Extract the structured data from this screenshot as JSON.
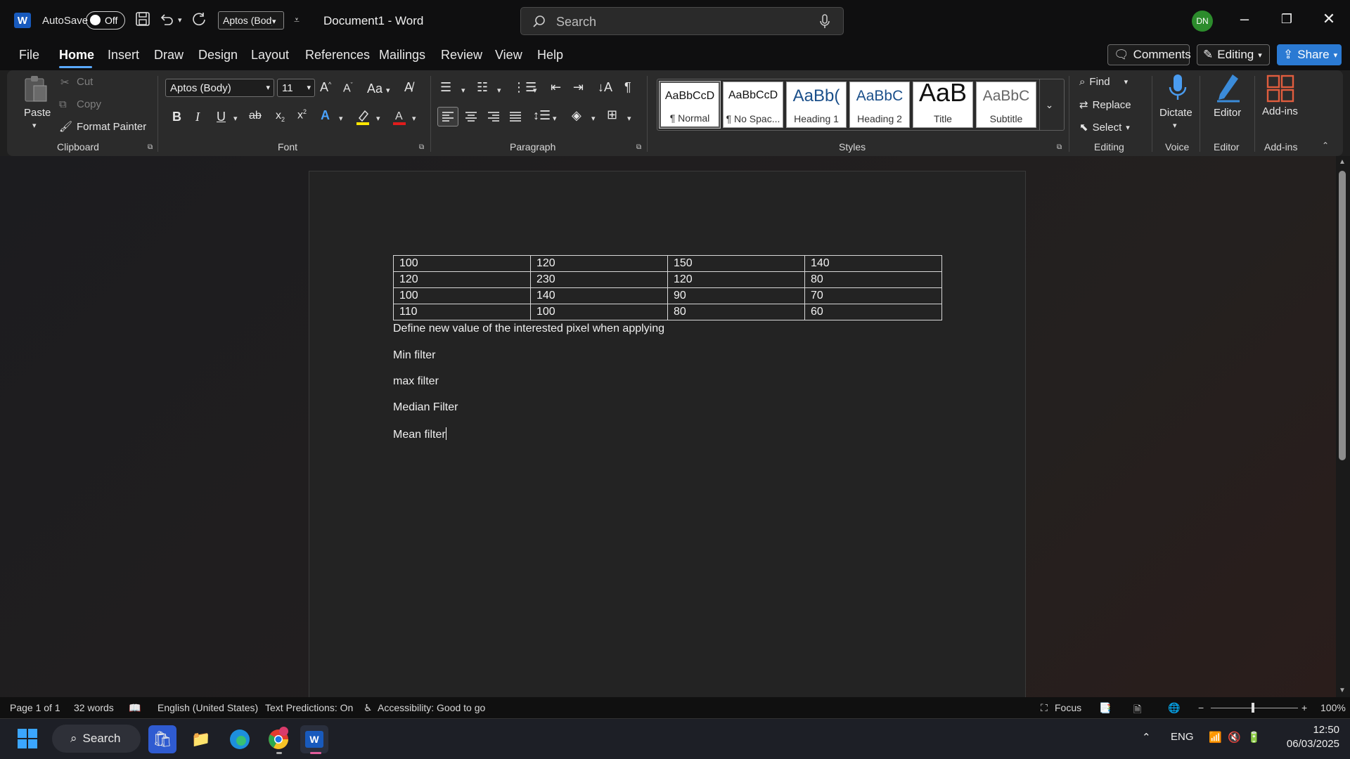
{
  "titlebar": {
    "autosave_label": "AutoSave",
    "autosave_state": "Off",
    "font_quick": "Aptos (Body)",
    "document_title": "Document1  -  Word",
    "search_placeholder": "Search",
    "user_initials": "DN"
  },
  "menu": {
    "tabs": [
      "File",
      "Home",
      "Insert",
      "Draw",
      "Design",
      "Layout",
      "References",
      "Mailings",
      "Review",
      "View",
      "Help"
    ],
    "active_tab": "Home",
    "comments_label": "Comments",
    "editing_label": "Editing",
    "share_label": "Share"
  },
  "ribbon": {
    "clipboard": {
      "paste": "Paste",
      "cut": "Cut",
      "copy": "Copy",
      "format_painter": "Format Painter",
      "label": "Clipboard"
    },
    "font": {
      "family": "Aptos (Body)",
      "size": "11",
      "label": "Font",
      "bold": "B",
      "italic": "I",
      "underline": "U",
      "strike": "ab",
      "change_case": "Aa"
    },
    "paragraph": {
      "label": "Paragraph"
    },
    "styles": {
      "label": "Styles",
      "items": [
        {
          "sample": "AaBbCcD",
          "name": "¶ Normal"
        },
        {
          "sample": "AaBbCcD",
          "name": "¶ No Spac..."
        },
        {
          "sample": "AaBb(",
          "name": "Heading 1"
        },
        {
          "sample": "AaBbC",
          "name": "Heading 2"
        },
        {
          "sample": "AaB",
          "name": "Title"
        },
        {
          "sample": "AaBbC",
          "name": "Subtitle"
        }
      ]
    },
    "editing": {
      "find": "Find",
      "replace": "Replace",
      "select": "Select",
      "label": "Editing"
    },
    "voice": {
      "dictate": "Dictate",
      "label": "Voice"
    },
    "editor": {
      "editor": "Editor",
      "label": "Editor"
    },
    "addins": {
      "addins": "Add-ins",
      "label": "Add-ins"
    }
  },
  "document": {
    "table": [
      [
        "100",
        "120",
        "150",
        "140"
      ],
      [
        "120",
        "230",
        "120",
        "80"
      ],
      [
        "100",
        "140",
        "90",
        "70"
      ],
      [
        "110",
        "100",
        "80",
        "60"
      ]
    ],
    "paragraphs": [
      "Define new value of the interested pixel when applying",
      "Min filter",
      "max filter",
      "Median Filter",
      "Mean filter"
    ]
  },
  "statusbar": {
    "page": "Page 1 of 1",
    "words": "32 words",
    "language": "English (United States)",
    "predictions": "Text Predictions: On",
    "accessibility": "Accessibility: Good to go",
    "focus": "Focus",
    "zoom": "100%"
  },
  "taskbar": {
    "search": "Search",
    "lang": "ENG",
    "time": "12:50",
    "date": "06/03/2025"
  },
  "colors": {
    "accent": "#2b7ad3",
    "underline": "#5aa9ff",
    "avatar": "#2c8c2c"
  }
}
